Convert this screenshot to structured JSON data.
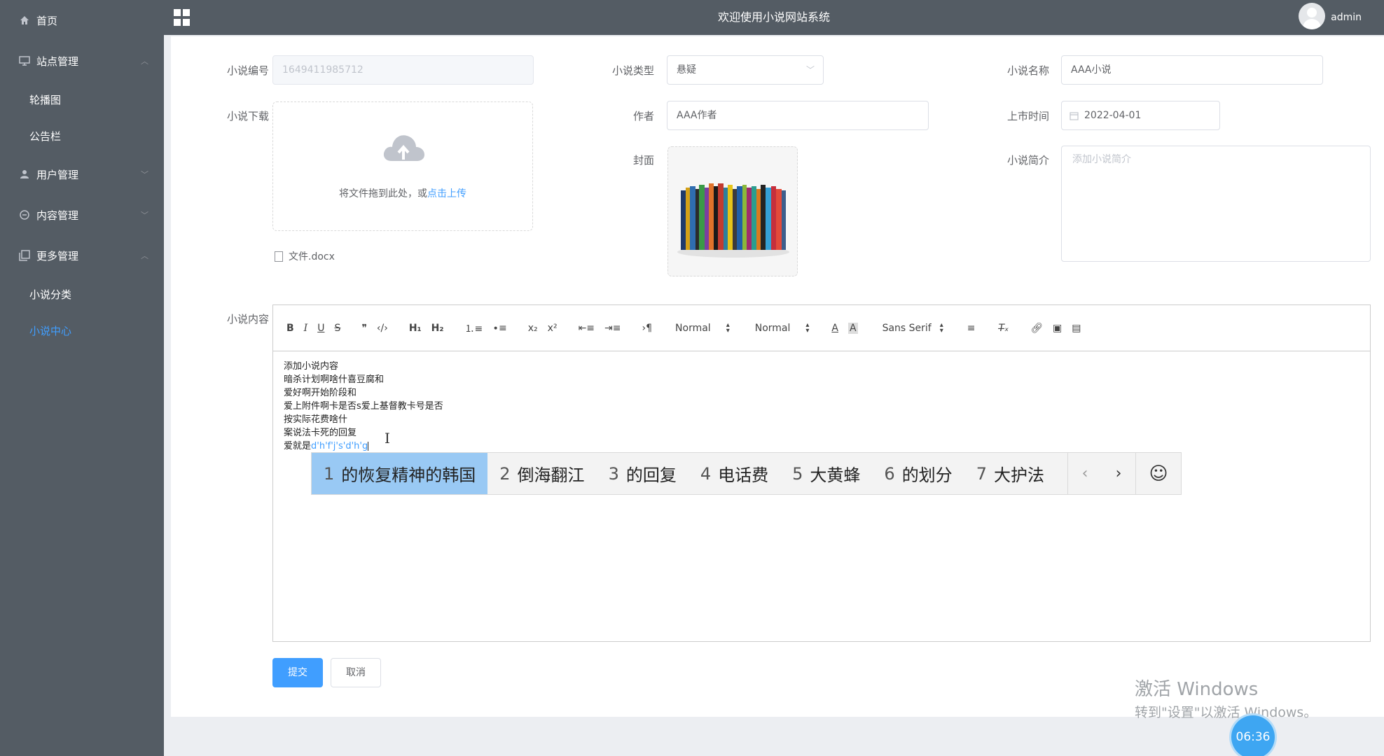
{
  "sidebar": {
    "home": "首页",
    "site_mgmt": "站点管理",
    "carousel": "轮播图",
    "notice": "公告栏",
    "user_mgmt": "用户管理",
    "content_mgmt": "内容管理",
    "more_mgmt": "更多管理",
    "novel_category": "小说分类",
    "novel_center": "小说中心"
  },
  "header": {
    "title": "欢迎使用小说网站系统",
    "user": "admin"
  },
  "form": {
    "id_label": "小说编号",
    "id_value": "1649411985712",
    "type_label": "小说类型",
    "type_value": "悬疑",
    "name_label": "小说名称",
    "name_value": "AAA小说",
    "download_label": "小说下载",
    "upload_text": "将文件拖到此处，或",
    "upload_link": "点击上传",
    "file_name": "文件.docx",
    "author_label": "作者",
    "author_value": "AAA作者",
    "date_label": "上市时间",
    "date_value": "2022-04-01",
    "cover_label": "封面",
    "intro_label": "小说简介",
    "intro_placeholder": "添加小说简介",
    "content_label": "小说内容"
  },
  "editor": {
    "header_select": "Normal",
    "size_select": "Normal",
    "font_select": "Sans Serif",
    "lines": [
      "添加小说内容",
      "暗杀计划啊啥什喜豆腐和",
      "爱好啊开始阶段和",
      "爱上附件啊卡是否s爱上基督教卡号是否",
      "按实际花费啥什",
      "案说法卡死的回复"
    ],
    "last_prefix": "爱就是",
    "last_typing": "d'h'f'j's'd'h'g"
  },
  "ime": {
    "candidates": [
      {
        "num": "1",
        "text": "的恢复精神的韩国"
      },
      {
        "num": "2",
        "text": "倒海翻江"
      },
      {
        "num": "3",
        "text": "的回复"
      },
      {
        "num": "4",
        "text": "电话费"
      },
      {
        "num": "5",
        "text": "大黄蜂"
      },
      {
        "num": "6",
        "text": "的划分"
      },
      {
        "num": "7",
        "text": "大护法"
      }
    ]
  },
  "buttons": {
    "submit": "提交",
    "cancel": "取消"
  },
  "watermark": {
    "line1": "激活 Windows",
    "line2": "转到\"设置\"以激活 Windows。"
  },
  "clock": "06:36"
}
